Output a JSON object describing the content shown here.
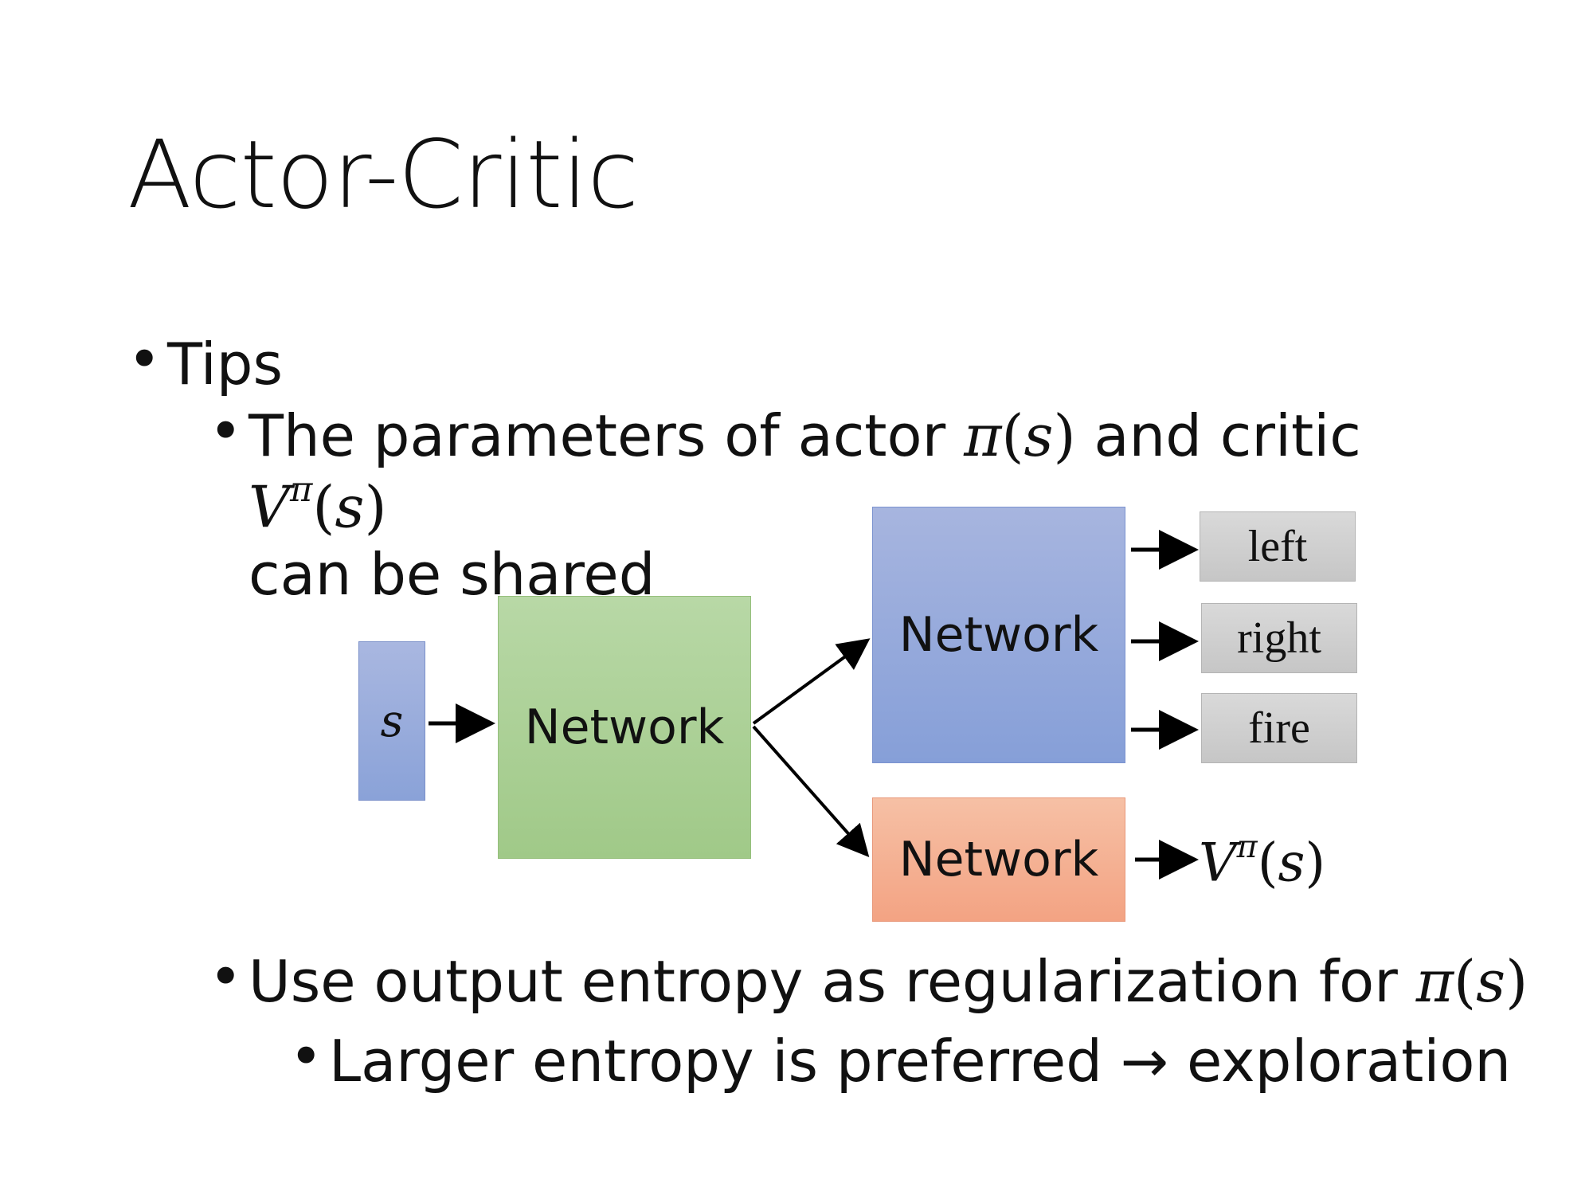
{
  "slide": {
    "title": "Actor-Critic",
    "bullets": {
      "tips": "Tips",
      "shared_prefix": "The parameters of actor ",
      "pi": "π",
      "s_paren_open": "(",
      "s": "s",
      "s_paren_close": ")",
      "shared_middle": " and critic ",
      "V": "V",
      "superscript_pi": "π",
      "shared_suffix": "can be shared",
      "entropy_prefix": "Use output entropy as regularization for ",
      "larger": "Larger entropy is preferred → exploration"
    },
    "diagram": {
      "input": "s",
      "shared_network": "Network",
      "actor_network": "Network",
      "critic_network": "Network",
      "actions": [
        "left",
        "right",
        "fire"
      ],
      "critic_output": "Vπ(s)"
    }
  }
}
